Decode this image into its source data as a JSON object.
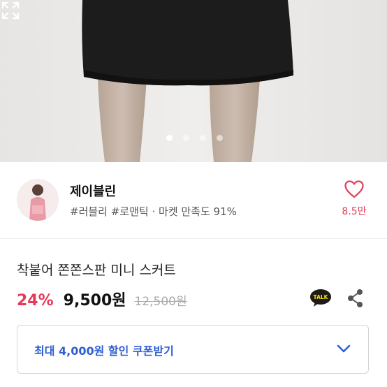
{
  "gallery": {
    "page_count": 4,
    "active_index": 0,
    "expand_icon": "expand-icon"
  },
  "seller": {
    "name": "제이블린",
    "tags": "#러블리 #로맨틱 · 마켓 만족도 91%",
    "like_icon": "heart-icon",
    "like_count": "8.5만"
  },
  "product": {
    "title": "착붙어 쫀쫀스판 미니 스커트",
    "discount": "24%",
    "price": "9,500원",
    "original_price": "12,500원",
    "talk_icon": "kakaotalk-icon",
    "talk_label": "TALK",
    "share_icon": "share-icon"
  },
  "coupon": {
    "label": "최대 4,000원 할인 쿠폰받기",
    "chevron_icon": "chevron-down-icon"
  },
  "colors": {
    "accent_pink": "#e8385a",
    "coupon_blue": "#2f5fd0",
    "talk_yellow": "#f9e000"
  }
}
